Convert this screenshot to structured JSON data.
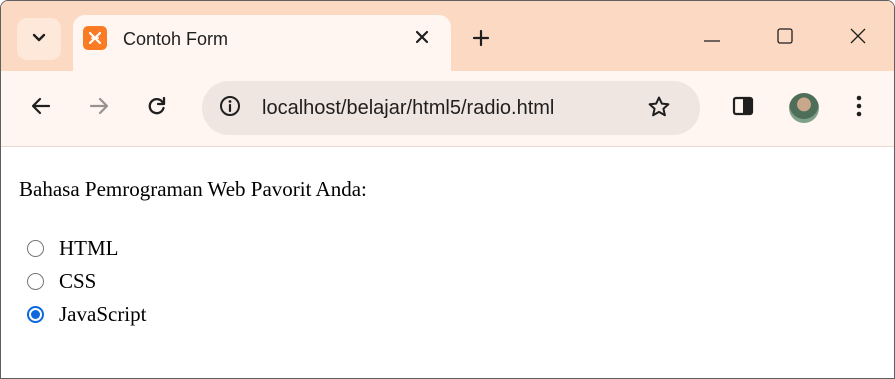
{
  "browser": {
    "tab": {
      "title": "Contoh Form",
      "favicon": "xampp-icon",
      "favicon_color": "#fb7a24"
    },
    "colors": {
      "tabstrip": "#fcd9c2",
      "toolbar": "#fff5f1",
      "omnibox": "#efe5e1"
    },
    "address_bar": {
      "url": "localhost/belajar/html5/radio.html"
    },
    "icons": {
      "tab_search": "chevron-down-icon",
      "tab_close": "close-icon",
      "new_tab": "plus-icon",
      "minimize": "minimize-icon",
      "maximize": "maximize-icon",
      "close": "close-icon",
      "back": "arrow-left-icon",
      "forward": "arrow-right-icon",
      "reload": "reload-icon",
      "site_info": "info-icon",
      "bookmark": "star-icon",
      "side_panel": "side-panel-icon",
      "profile": "avatar",
      "menu": "kebab-menu-icon"
    }
  },
  "page": {
    "prompt": "Bahasa Pemrograman Web Pavorit Anda:",
    "options": [
      {
        "label": "HTML",
        "checked": false
      },
      {
        "label": "CSS",
        "checked": false
      },
      {
        "label": "JavaScript",
        "checked": true
      }
    ],
    "accent_color": "#0b69dd"
  }
}
